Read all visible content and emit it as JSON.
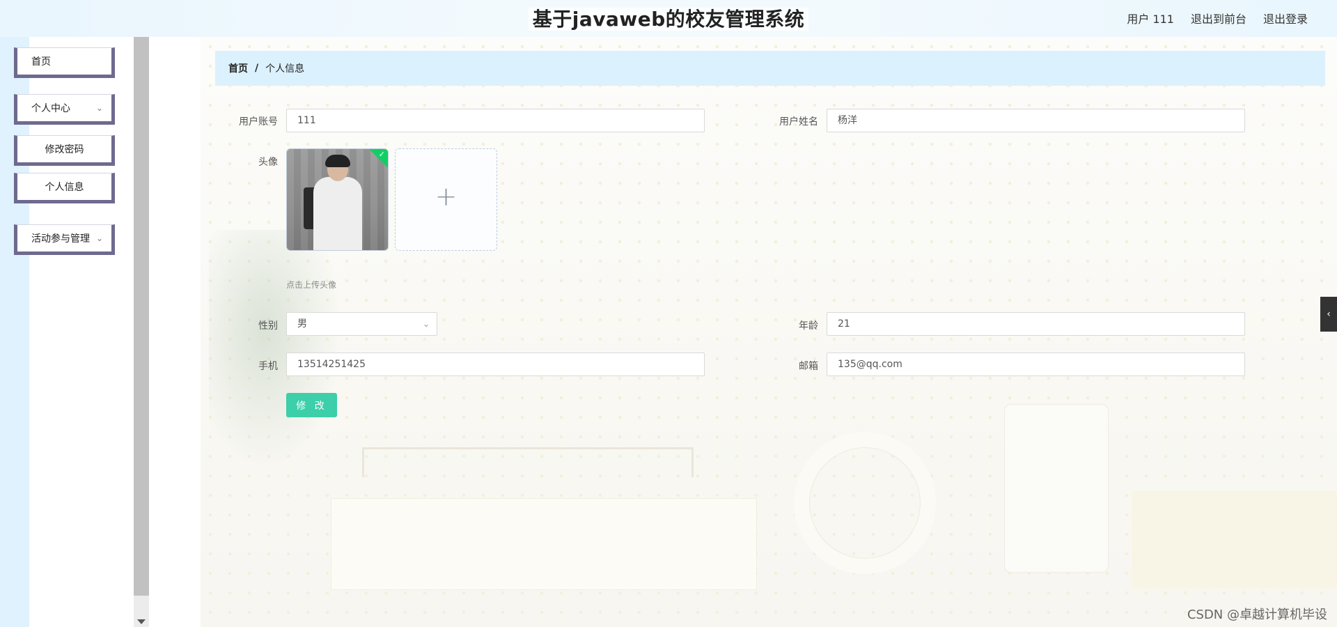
{
  "header": {
    "title": "基于javaweb的校友管理系统",
    "user_label": "用户 111",
    "back_to_front": "退出到前台",
    "logout": "退出登录"
  },
  "sidebar": {
    "items": [
      {
        "label": "首页"
      },
      {
        "label": "个人中心",
        "expandable": true
      },
      {
        "label": "修改密码"
      },
      {
        "label": "个人信息"
      },
      {
        "label": "活动参与管理",
        "expandable": true
      }
    ]
  },
  "breadcrumb": {
    "home": "首页",
    "separator": "/",
    "current": "个人信息"
  },
  "form": {
    "account": {
      "label": "用户账号",
      "value": "111"
    },
    "name": {
      "label": "用户姓名",
      "value": "杨洋"
    },
    "avatar": {
      "label": "头像",
      "hint": "点击上传头像",
      "uploaded": true
    },
    "gender": {
      "label": "性别",
      "value": "男"
    },
    "age": {
      "label": "年龄",
      "value": "21"
    },
    "phone": {
      "label": "手机",
      "value": "13514251425"
    },
    "email": {
      "label": "邮箱",
      "value": "135@qq.com"
    },
    "submit": "修 改"
  },
  "watermark": "CSDN @卓越计算机毕设",
  "colors": {
    "accent": "#3ccfa9",
    "breadcrumb_bg": "#dbf1fd",
    "menu_border": "#6e6a8f"
  }
}
